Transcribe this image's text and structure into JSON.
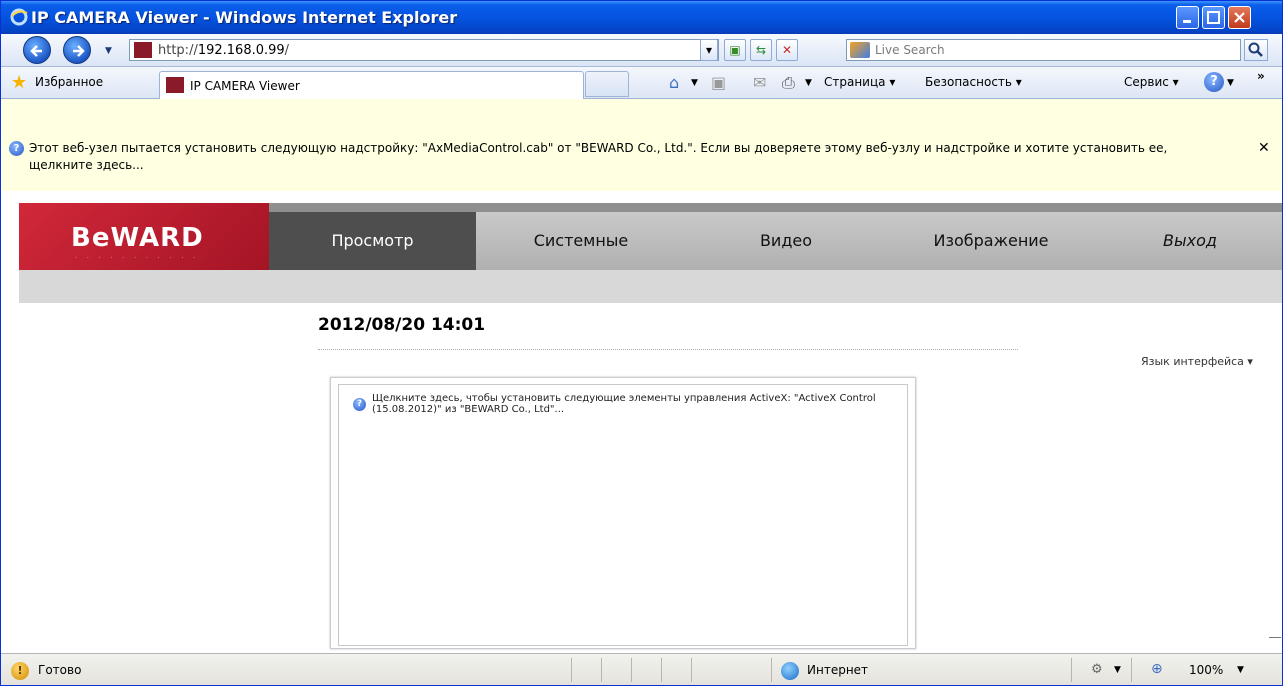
{
  "window": {
    "title": "IP CAMERA Viewer - Windows Internet Explorer"
  },
  "address": {
    "url_prefix": "http://",
    "url_host": "192.168.0.99",
    "url_suffix": "/",
    "search_placeholder": "Live Search"
  },
  "tabbar": {
    "favorites_label": "Избранное",
    "tab_title": "IP CAMERA Viewer",
    "commands": {
      "page": "Страница",
      "safety": "Безопасность",
      "tools": "Сервис"
    }
  },
  "infobar": {
    "message": "Этот веб-узел пытается установить следующую надстройку: \"AxMediaControl.cab\" от \"BEWARD Co., Ltd.\". Если вы доверяете этому веб-узлу и надстройке и хотите установить ее, щелкните здесь..."
  },
  "site": {
    "logo_text": "BeWARD",
    "nav": {
      "view": "Просмотр",
      "system": "Системные",
      "video": "Видео",
      "image": "Изображение",
      "logout": "Выход"
    },
    "datetime": "2012/08/20 14:01",
    "language_label": "Язык интерфейса",
    "activex_message": "Щелкните здесь, чтобы установить следующие элементы управления ActiveX: \"ActiveX Control (15.08.2012)\" из \"BEWARD Co., Ltd\"..."
  },
  "statusbar": {
    "status": "Готово",
    "zone": "Интернет",
    "zoom": "100%"
  },
  "colors": {
    "titlebar": "#0553e1",
    "infobar": "#ffffe1",
    "brand_red": "#c8202f",
    "nav_active": "#4e4e4e"
  }
}
